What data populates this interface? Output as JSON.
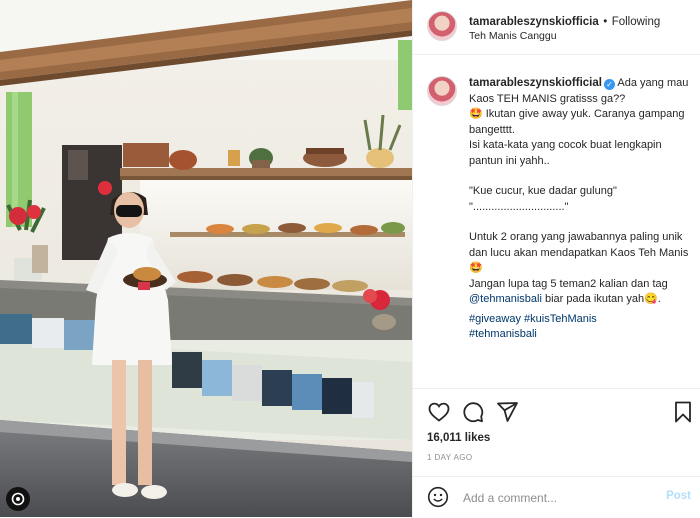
{
  "post": {
    "username": "tamarableszynskiofficial",
    "header_username": "tamarableszynskiofficia",
    "follow_dot": "•",
    "follow_label": "Following",
    "location": "Teh Manis Canggu",
    "more_label": "⋯",
    "caption_lines": [
      "Ada yang mau Kaos TEH MANIS gratisss ga??",
      "🤩 Ikutan give away yuk. Caranya gampang bangetttt.",
      "Isi kata-kata yang cocok buat lengkapin pantun ini yahh..",
      "",
      "\"Kue cucur, kue dadar gulung\"",
      "\"..............................\"",
      "",
      "Untuk 2 orang yang jawabannya paling unik dan lucu akan mendapatkan Kaos Teh Manis 🤩",
      "Jangan lupa tag 5 teman2 kalian dan tag",
      "biar pada ikutan yah😋."
    ],
    "mention": "@tehmanisbali",
    "hashtags": [
      "#giveaway",
      "#kuisTehManis",
      "#tehmanisbali"
    ],
    "likes": "16,011 likes",
    "age": "1 DAY AGO",
    "comment_placeholder": "Add a comment...",
    "post_label": "Post",
    "icons": [
      "heart-icon",
      "comment-icon",
      "share-icon",
      "bookmark-icon",
      "emoji-icon",
      "threads-logo-icon"
    ]
  }
}
